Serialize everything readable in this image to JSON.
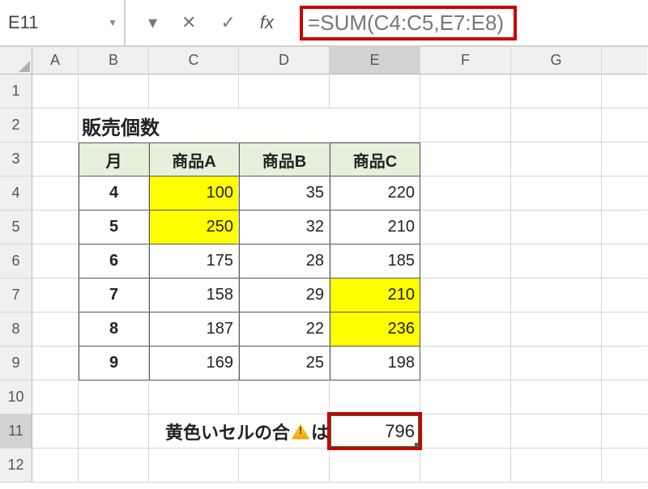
{
  "name_box": "E11",
  "formula": "=SUM(C4:C5,E7:E8)",
  "columns": [
    "A",
    "B",
    "C",
    "D",
    "E",
    "F",
    "G"
  ],
  "rows": [
    "1",
    "2",
    "3",
    "4",
    "5",
    "6",
    "7",
    "8",
    "9",
    "10",
    "11",
    "12"
  ],
  "title_cell": "販売個数",
  "headers": {
    "month": "月",
    "a": "商品A",
    "b": "商品B",
    "c": "商品C"
  },
  "table": [
    {
      "m": "4",
      "a": "100",
      "b": "35",
      "c": "220"
    },
    {
      "m": "5",
      "a": "250",
      "b": "32",
      "c": "210"
    },
    {
      "m": "6",
      "a": "175",
      "b": "28",
      "c": "185"
    },
    {
      "m": "7",
      "a": "158",
      "b": "29",
      "c": "210"
    },
    {
      "m": "8",
      "a": "187",
      "b": "22",
      "c": "236"
    },
    {
      "m": "9",
      "a": "169",
      "b": "25",
      "c": "198"
    }
  ],
  "sum_label_pre": "黄色いセルの合",
  "sum_label_post": "は",
  "sum_value": "796",
  "highlight": {
    "a": [
      0,
      1
    ],
    "c": [
      3,
      4
    ]
  },
  "colors": {
    "accent_red": "#c90000",
    "hl_yellow": "#ffff00",
    "hdr_green": "#e6f1dc"
  }
}
